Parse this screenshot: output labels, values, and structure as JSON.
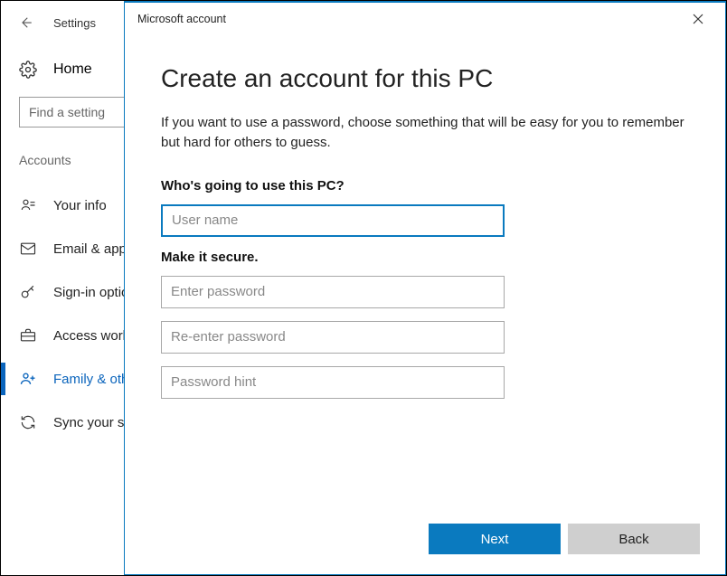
{
  "settings": {
    "back_title": "Settings",
    "home_label": "Home",
    "search_placeholder": "Find a setting",
    "section_heading": "Accounts",
    "nav": [
      {
        "label": "Your info"
      },
      {
        "label": "Email & app accounts"
      },
      {
        "label": "Sign-in options"
      },
      {
        "label": "Access work or school"
      },
      {
        "label": "Family & other people"
      },
      {
        "label": "Sync your settings"
      }
    ]
  },
  "modal": {
    "title": "Microsoft account",
    "heading": "Create an account for this PC",
    "description": "If you want to use a password, choose something that will be easy for you to remember but hard for others to guess.",
    "q_who": "Who's going to use this PC?",
    "username_placeholder": "User name",
    "q_secure": "Make it secure.",
    "pw_placeholder": "Enter password",
    "pw2_placeholder": "Re-enter password",
    "hint_placeholder": "Password hint",
    "next_label": "Next",
    "back_label": "Back"
  }
}
